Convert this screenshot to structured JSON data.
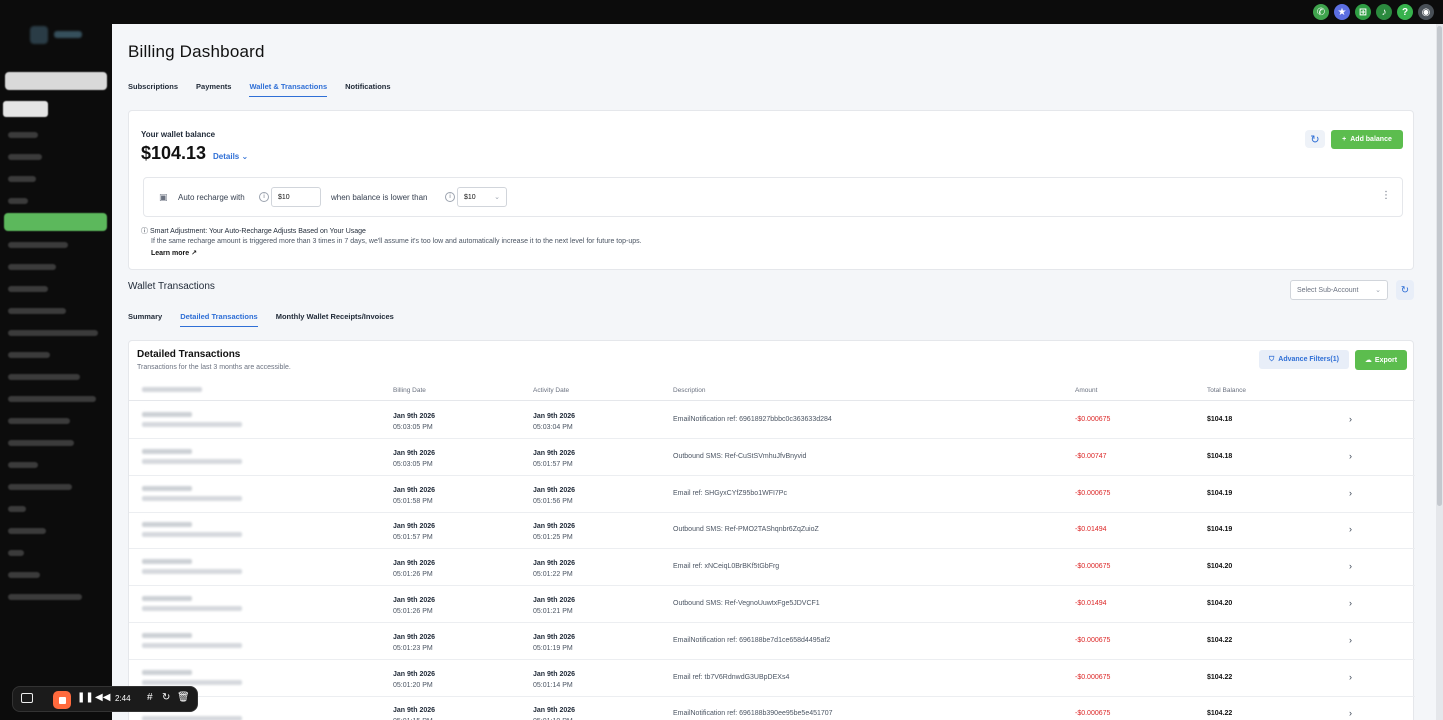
{
  "page": {
    "title": "Billing Dashboard"
  },
  "tabs": [
    {
      "label": "Subscriptions",
      "active": false
    },
    {
      "label": "Payments",
      "active": false
    },
    {
      "label": "Wallet & Transactions",
      "active": true
    },
    {
      "label": "Notifications",
      "active": false
    }
  ],
  "wallet": {
    "label": "Your wallet balance",
    "amount": "$104.13",
    "details": "Details",
    "add_balance": "Add balance",
    "recharge_text": "Auto recharge with",
    "recharge_value": "$10",
    "threshold_text": "when balance is lower than",
    "threshold_value": "$10",
    "smart_title": "Smart Adjustment: Your Auto-Recharge Adjusts Based on Your Usage",
    "smart_desc": "If the same recharge amount is triggered more than 3 times in 7 days, we'll assume it's too low and automatically increase it to the next level for future top-ups.",
    "learn_more": "Learn more"
  },
  "transactions": {
    "title": "Wallet Transactions",
    "subaccount_placeholder": "Select Sub-Account",
    "subtabs": [
      {
        "label": "Summary",
        "active": false
      },
      {
        "label": "Detailed Transactions",
        "active": true
      },
      {
        "label": "Monthly Wallet Receipts/Invoices",
        "active": false
      }
    ],
    "detail_title": "Detailed Transactions",
    "detail_sub": "Transactions for the last 3 months are accessible.",
    "advance_filters": "Advance Filters(1)",
    "export": "Export",
    "columns": [
      "Billing Date",
      "Activity Date",
      "Description",
      "Amount",
      "Total Balance"
    ],
    "rows": [
      {
        "billing_date": "Jan 9th 2026",
        "billing_time": "05:03:05 PM",
        "activity_date": "Jan 9th 2026",
        "activity_time": "05:03:04 PM",
        "description": "EmailNotification ref: 69618927bbbc0c363633d284",
        "amount": "-$0.000675",
        "balance": "$104.18"
      },
      {
        "billing_date": "Jan 9th 2026",
        "billing_time": "05:03:05 PM",
        "activity_date": "Jan 9th 2026",
        "activity_time": "05:01:57 PM",
        "description": "Outbound SMS: Ref-CuStSVmhuJfvBnyvid",
        "amount": "-$0.00747",
        "balance": "$104.18"
      },
      {
        "billing_date": "Jan 9th 2026",
        "billing_time": "05:01:58 PM",
        "activity_date": "Jan 9th 2026",
        "activity_time": "05:01:56 PM",
        "description": "Email ref: SHGyxCYfZ95bo1WFI7Pc",
        "amount": "-$0.000675",
        "balance": "$104.19"
      },
      {
        "billing_date": "Jan 9th 2026",
        "billing_time": "05:01:57 PM",
        "activity_date": "Jan 9th 2026",
        "activity_time": "05:01:25 PM",
        "description": "Outbound SMS: Ref-PMO2TAShqnbr6ZqZuioZ",
        "amount": "-$0.01494",
        "balance": "$104.19"
      },
      {
        "billing_date": "Jan 9th 2026",
        "billing_time": "05:01:26 PM",
        "activity_date": "Jan 9th 2026",
        "activity_time": "05:01:22 PM",
        "description": "Email ref: xNCeiqL0BrBKf5tGbFrg",
        "amount": "-$0.000675",
        "balance": "$104.20"
      },
      {
        "billing_date": "Jan 9th 2026",
        "billing_time": "05:01:26 PM",
        "activity_date": "Jan 9th 2026",
        "activity_time": "05:01:21 PM",
        "description": "Outbound SMS: Ref-VegnoUuwtxFge5JDVCF1",
        "amount": "-$0.01494",
        "balance": "$104.20"
      },
      {
        "billing_date": "Jan 9th 2026",
        "billing_time": "05:01:23 PM",
        "activity_date": "Jan 9th 2026",
        "activity_time": "05:01:19 PM",
        "description": "EmailNotification ref: 696188be7d1ce658d4495af2",
        "amount": "-$0.000675",
        "balance": "$104.22"
      },
      {
        "billing_date": "Jan 9th 2026",
        "billing_time": "05:01:20 PM",
        "activity_date": "Jan 9th 2026",
        "activity_time": "05:01:14 PM",
        "description": "Email ref: tb7V6RdnwdG3UBpDEXs4",
        "amount": "-$0.000675",
        "balance": "$104.22"
      },
      {
        "billing_date": "Jan 9th 2026",
        "billing_time": "05:01:15 PM",
        "activity_date": "Jan 9th 2026",
        "activity_time": "05:01:10 PM",
        "description": "EmailNotification ref: 696188b390ee95be5e451707",
        "amount": "-$0.000675",
        "balance": "$104.22"
      }
    ]
  },
  "recorder": {
    "time": "2:44"
  },
  "icons": {
    "topbar": [
      "phone-icon",
      "star-icon",
      "cart-icon",
      "bell-icon",
      "help-icon",
      "avatar"
    ],
    "colors": [
      "#5cbd4e",
      "#2f6fd6",
      "#2f9e44",
      "#2b8a3e",
      "#37b24d",
      "#495057"
    ]
  }
}
